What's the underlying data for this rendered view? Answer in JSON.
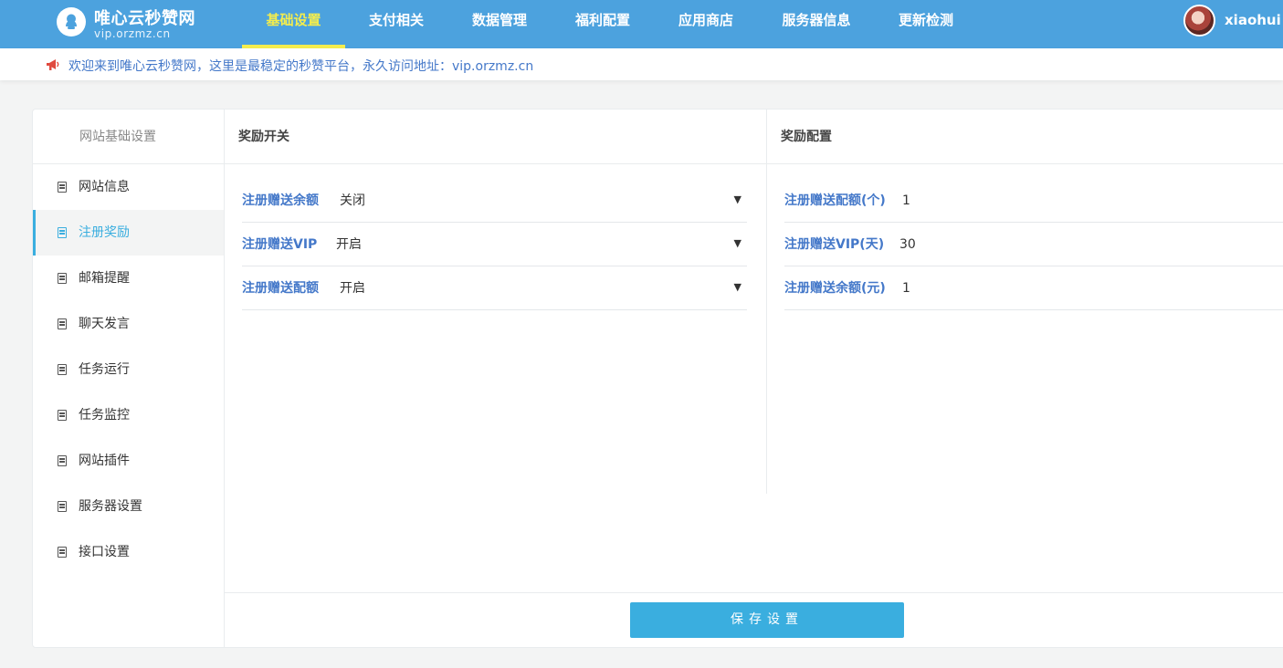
{
  "header": {
    "brand_title": "唯心云秒赞网",
    "brand_subtitle": "vip.orzmz.cn",
    "nav": [
      {
        "label": "基础设置",
        "active": true
      },
      {
        "label": "支付相关",
        "active": false
      },
      {
        "label": "数据管理",
        "active": false
      },
      {
        "label": "福利配置",
        "active": false
      },
      {
        "label": "应用商店",
        "active": false
      },
      {
        "label": "服务器信息",
        "active": false
      },
      {
        "label": "更新检测",
        "active": false
      }
    ],
    "username": "xiaohui"
  },
  "notice": {
    "icon": "megaphone-icon",
    "text": "欢迎来到唯心云秒赞网，这里是最稳定的秒赞平台，永久访问地址：vip.orzmz.cn"
  },
  "sidebar": {
    "title": "网站基础设置",
    "items": [
      {
        "label": "网站信息",
        "active": false
      },
      {
        "label": "注册奖励",
        "active": true
      },
      {
        "label": "邮箱提醒",
        "active": false
      },
      {
        "label": "聊天发言",
        "active": false
      },
      {
        "label": "任务运行",
        "active": false
      },
      {
        "label": "任务监控",
        "active": false
      },
      {
        "label": "网站插件",
        "active": false
      },
      {
        "label": "服务器设置",
        "active": false
      },
      {
        "label": "接口设置",
        "active": false
      }
    ]
  },
  "switches": {
    "heading": "奖励开关",
    "rows": [
      {
        "label": "注册赠送余额",
        "value": "关闭"
      },
      {
        "label": "注册赠送VIP",
        "value": "开启"
      },
      {
        "label": "注册赠送配额",
        "value": "开启"
      }
    ]
  },
  "config": {
    "heading": "奖励配置",
    "rows": [
      {
        "label": "注册赠送配额(个)",
        "value": "1"
      },
      {
        "label": "注册赠送VIP(天)",
        "value": "30"
      },
      {
        "label": "注册赠送余额(元)",
        "value": "1"
      }
    ]
  },
  "save_label": "保存设置",
  "colors": {
    "header_bg": "#4ca2de",
    "nav_active": "#f4ed4d",
    "accent": "#3aaedf",
    "label_blue": "#4478c9",
    "notice_icon": "#e04a3f"
  }
}
